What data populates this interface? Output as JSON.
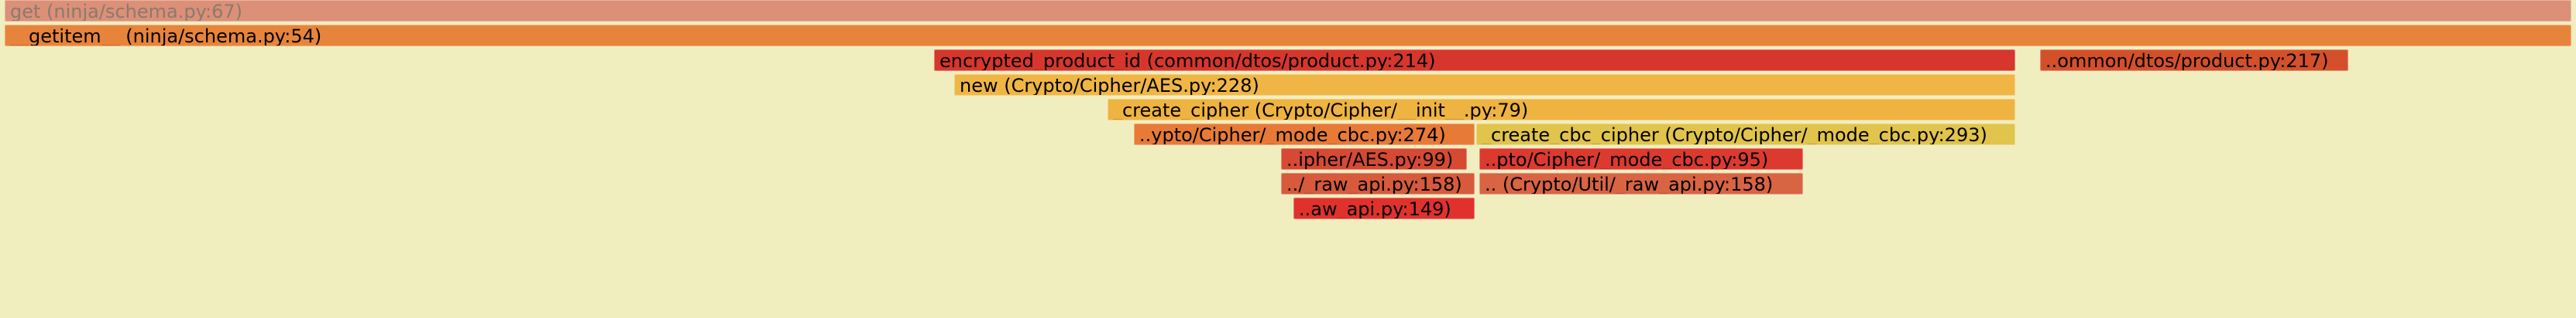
{
  "frames": [
    {
      "id": "f1",
      "label": "get (ninja/schema.py:67)",
      "color": "#dc9077",
      "dim": true
    },
    {
      "id": "f2",
      "label": "__getitem__ (ninja/schema.py:54)",
      "color": "#e7843b"
    },
    {
      "id": "f3",
      "label": "encrypted_product_id (common/dtos/product.py:214)",
      "color": "#d7362c"
    },
    {
      "id": "f4",
      "label": "..ommon/dtos/product.py:217)",
      "color": "#d4502a"
    },
    {
      "id": "f5",
      "label": "new (Crypto/Cipher/AES.py:228)",
      "color": "#efb646"
    },
    {
      "id": "f6",
      "label": "_create_cipher (Crypto/Cipher/__init__.py:79)",
      "color": "#efb341"
    },
    {
      "id": "f7",
      "label": "..ypto/Cipher/_mode_cbc.py:274)",
      "color": "#e87a37"
    },
    {
      "id": "f8",
      "label": "_create_cbc_cipher (Crypto/Cipher/_mode_cbc.py:293)",
      "color": "#e0c44c"
    },
    {
      "id": "f9",
      "label": "..ipher/AES.py:99)",
      "color": "#d64a33"
    },
    {
      "id": "f10",
      "label": "..pto/Cipher/_mode_cbc.py:95)",
      "color": "#dd3a2f"
    },
    {
      "id": "f11",
      "label": "../_raw_api.py:158)",
      "color": "#d75a3c"
    },
    {
      "id": "f12",
      "label": ".. (Crypto/Util/_raw_api.py:158)",
      "color": "#d86444"
    },
    {
      "id": "f13",
      "label": "..aw_api.py:149)",
      "color": "#e1312c"
    }
  ]
}
